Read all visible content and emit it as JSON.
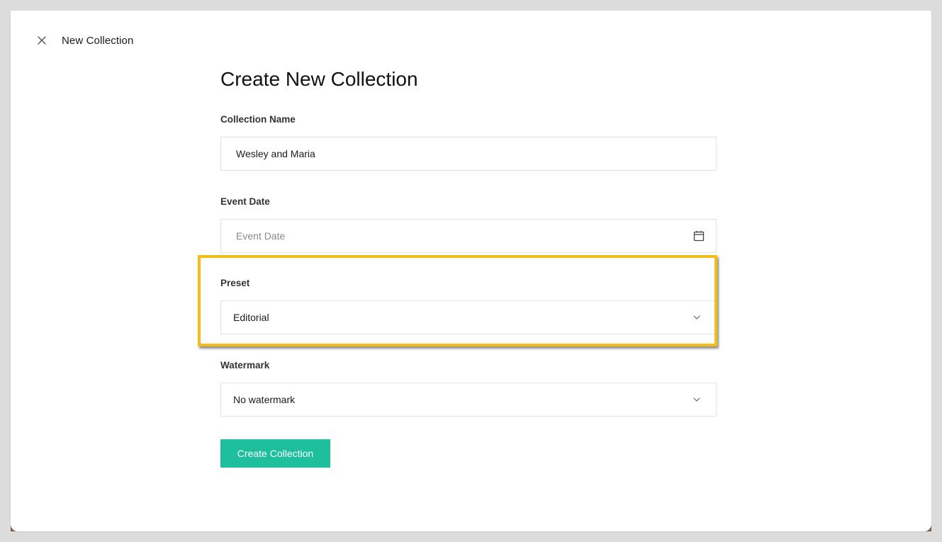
{
  "header": {
    "close_icon": "close-icon",
    "title": "New Collection"
  },
  "form": {
    "heading": "Create New Collection",
    "collection_name": {
      "label": "Collection Name",
      "value": "Wesley and Maria"
    },
    "event_date": {
      "label": "Event Date",
      "placeholder": "Event Date",
      "icon": "calendar-icon"
    },
    "preset": {
      "label": "Preset",
      "selected": "Editorial",
      "icon": "chevron-down-icon"
    },
    "watermark": {
      "label": "Watermark",
      "selected": "No watermark",
      "icon": "chevron-down-icon"
    },
    "submit_label": "Create Collection"
  },
  "colors": {
    "accent_button": "#1dbf9c",
    "highlight_border": "#f3bd17"
  }
}
